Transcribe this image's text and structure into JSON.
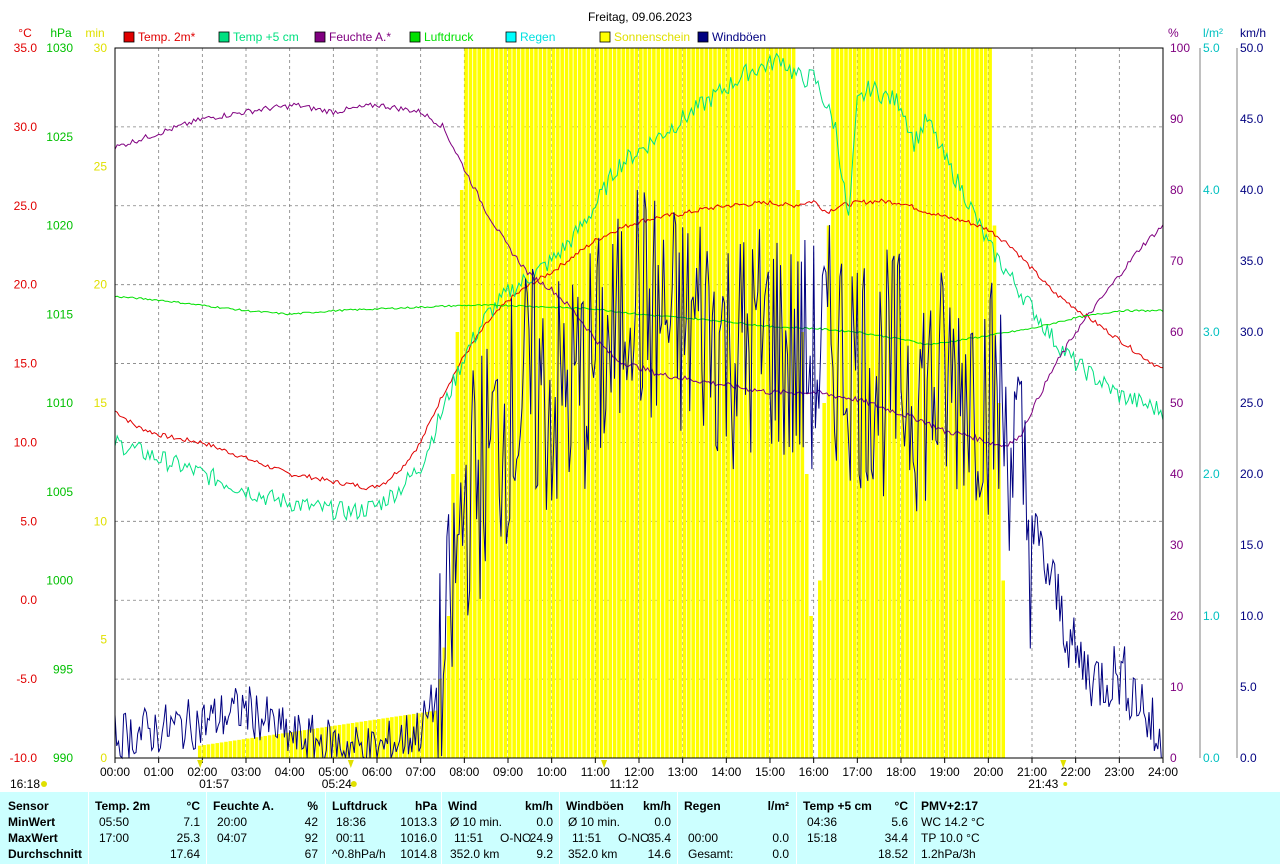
{
  "title": "Freitag, 09.06.2023",
  "colors": {
    "temp": "#e00000",
    "temp5": "#00e080",
    "humidity": "#800080",
    "pressure": "#00e000",
    "rain": "#00ffff",
    "sun": "#ffff00",
    "gust": "#000080",
    "yellow_axis": "#e0e000",
    "grid": "#808080"
  },
  "axes": {
    "left": [
      {
        "unit": "°C",
        "color": "#e00000",
        "ticks": [
          "35.0",
          "30.0",
          "25.0",
          "20.0",
          "15.0",
          "10.0",
          "5.0",
          "0.0",
          "-5.0",
          "-10.0"
        ]
      },
      {
        "unit": "hPa",
        "color": "#00c000",
        "ticks": [
          "1030",
          "1025",
          "1020",
          "1015",
          "1010",
          "1005",
          "1000",
          "995",
          "990"
        ]
      },
      {
        "unit": "min",
        "color": "#e0e000",
        "ticks": [
          "30",
          "25",
          "20",
          "15",
          "10",
          "5",
          "0"
        ]
      }
    ],
    "right": [
      {
        "unit": "%",
        "color": "#800080",
        "ticks": [
          "100",
          "90",
          "80",
          "70",
          "60",
          "50",
          "40",
          "30",
          "20",
          "10",
          "0"
        ]
      },
      {
        "unit": "l/m²",
        "color": "#00c0c0",
        "ticks": [
          "5.0",
          "4.0",
          "3.0",
          "2.0",
          "1.0",
          "0.0"
        ]
      },
      {
        "unit": "km/h",
        "color": "#000080",
        "ticks": [
          "50.0",
          "45.0",
          "40.0",
          "35.0",
          "30.0",
          "25.0",
          "20.0",
          "15.0",
          "10.0",
          "5.0",
          "0.0"
        ]
      }
    ],
    "x_ticks": [
      "00:00",
      "01:00",
      "02:00",
      "03:00",
      "04:00",
      "05:00",
      "06:00",
      "07:00",
      "08:00",
      "09:00",
      "10:00",
      "11:00",
      "12:00",
      "13:00",
      "14:00",
      "15:00",
      "16:00",
      "17:00",
      "18:00",
      "19:00",
      "20:00",
      "21:00",
      "22:00",
      "23:00",
      "24:00"
    ]
  },
  "legend": [
    {
      "label": "Temp. 2m*",
      "color": "#e00000"
    },
    {
      "label": "Temp +5 cm",
      "color": "#00e080"
    },
    {
      "label": "Feuchte A.*",
      "color": "#800080"
    },
    {
      "label": "Luftdruck",
      "color": "#00e000"
    },
    {
      "label": "Regen",
      "color": "#00ffff"
    },
    {
      "label": "Sonnenschein",
      "color": "#ffff00"
    },
    {
      "label": "Windböen",
      "color": "#000080"
    }
  ],
  "markers": {
    "left_time": "16:18",
    "sunrise": "05:24",
    "moon_a": "01:57",
    "noon": "11:12",
    "sunset": "21:43"
  },
  "chart_data": {
    "type": "line",
    "x_unit": "hour of day",
    "xlim": [
      0,
      24
    ],
    "series": [
      {
        "name": "Temp. 2m*",
        "unit": "°C",
        "ylim": [
          -10,
          35
        ],
        "x": [
          0,
          0.5,
          1,
          1.5,
          2,
          2.5,
          3,
          3.5,
          4,
          4.5,
          5,
          5.5,
          5.83,
          6.2,
          6.6,
          7,
          7.5,
          8,
          8.5,
          9,
          9.5,
          10,
          10.5,
          11,
          11.5,
          12,
          12.5,
          13,
          13.5,
          14,
          14.5,
          15,
          15.5,
          16,
          16.3,
          16.6,
          17,
          17.5,
          18,
          18.5,
          19,
          19.5,
          20,
          20.5,
          21,
          21.5,
          22,
          22.5,
          23,
          23.5,
          24
        ],
        "y": [
          12,
          11,
          10.5,
          10.2,
          10,
          9.5,
          9,
          8.5,
          8,
          7.8,
          7.5,
          7.3,
          7.1,
          7.5,
          8.5,
          10,
          13,
          15.5,
          17.5,
          19,
          20,
          20.8,
          21.8,
          22.8,
          23.5,
          24,
          24.3,
          24.5,
          24.8,
          25,
          25.1,
          25.2,
          25,
          25.3,
          24.6,
          25,
          25.2,
          25.3,
          25.2,
          24.7,
          24.3,
          24,
          23.5,
          22.5,
          21,
          19.5,
          18.5,
          17.5,
          16.5,
          15.5,
          14.6
        ]
      },
      {
        "name": "Temp +5 cm",
        "unit": "°C",
        "ylim": [
          -10,
          35
        ],
        "x": [
          0,
          0.5,
          1,
          1.5,
          2,
          2.5,
          3,
          3.5,
          4,
          4.5,
          5,
          5.5,
          6,
          6.5,
          7,
          7.5,
          8,
          8.5,
          9,
          9.5,
          10,
          10.5,
          11,
          11.5,
          12,
          12.5,
          13,
          13.5,
          14,
          14.5,
          15,
          15.25,
          15.5,
          15.75,
          16,
          16.5,
          16.8,
          17,
          17.3,
          17.6,
          18,
          18.3,
          18.6,
          19,
          19.5,
          20,
          20.5,
          21,
          21.5,
          22,
          22.5,
          23,
          23.5,
          24
        ],
        "y": [
          10,
          9.5,
          9,
          8.5,
          8,
          7.5,
          7,
          6.5,
          6.2,
          5.9,
          5.7,
          5.6,
          6,
          7,
          8.5,
          12,
          15.5,
          18,
          19.5,
          20.5,
          21.5,
          23,
          25,
          27.5,
          28.5,
          29.5,
          30.5,
          31.5,
          32.5,
          33.5,
          34,
          34.4,
          33.5,
          33,
          33.2,
          30,
          24,
          31.5,
          32.5,
          32,
          31.5,
          29,
          30.5,
          28,
          25.5,
          22.5,
          20.5,
          18.5,
          16.5,
          15,
          14,
          13,
          12.5,
          12
        ]
      },
      {
        "name": "Feuchte A.*",
        "unit": "%",
        "ylim": [
          0,
          100
        ],
        "x": [
          0,
          0.5,
          1,
          1.5,
          2,
          2.5,
          3,
          3.5,
          4,
          4.12,
          4.5,
          5,
          5.5,
          6,
          6.5,
          7,
          7.5,
          8,
          8.5,
          9,
          9.5,
          10,
          10.5,
          11,
          11.5,
          12,
          12.5,
          13,
          13.5,
          14,
          14.5,
          15,
          15.5,
          16,
          16.5,
          17,
          17.5,
          18,
          18.5,
          19,
          19.5,
          20,
          20.33,
          20.7,
          21,
          21.5,
          22,
          22.5,
          23,
          23.5,
          24
        ],
        "y": [
          86,
          87,
          88,
          89,
          90,
          90.5,
          91,
          91.5,
          91.8,
          92,
          91.5,
          91,
          91.5,
          92,
          91.5,
          91,
          89,
          83,
          77,
          72,
          68,
          66,
          63,
          59,
          56,
          55,
          54,
          53.5,
          53,
          52.5,
          52,
          51.5,
          51.5,
          51.5,
          51,
          50.5,
          49.5,
          48.5,
          47.5,
          46,
          45.5,
          44.5,
          44,
          45,
          49,
          55,
          60,
          64,
          68,
          72,
          75
        ]
      },
      {
        "name": "Luftdruck",
        "unit": "hPa",
        "ylim": [
          990,
          1030
        ],
        "x": [
          0,
          1,
          2,
          3,
          4,
          5,
          6,
          7,
          8,
          9,
          10,
          11,
          12,
          13,
          14,
          15,
          16,
          17,
          18,
          18.6,
          19,
          20,
          21,
          22,
          23,
          24
        ],
        "y": [
          1016,
          1015.8,
          1015.5,
          1015.2,
          1015,
          1015.2,
          1015.3,
          1015.4,
          1015.5,
          1015.5,
          1015.4,
          1015.3,
          1015,
          1014.8,
          1014.6,
          1014.3,
          1014.2,
          1014,
          1013.6,
          1013.3,
          1013.4,
          1013.8,
          1014.2,
          1014.8,
          1015.2,
          1015.2
        ]
      },
      {
        "name": "Windböen",
        "unit": "km/h",
        "ylim": [
          0,
          50
        ],
        "x": [
          0,
          1,
          2,
          3,
          4,
          5,
          6,
          7,
          7.5,
          8,
          8.5,
          9,
          9.5,
          10,
          10.5,
          11,
          11.5,
          11.85,
          12,
          12.5,
          13,
          13.5,
          14,
          14.5,
          15,
          15.5,
          16,
          16.5,
          17,
          17.5,
          18,
          18.5,
          19,
          19.5,
          20,
          20.5,
          21,
          21.5,
          22,
          22.5,
          23,
          23.5,
          24
        ],
        "y": [
          1.5,
          2,
          2.5,
          3.5,
          1.5,
          1,
          0.5,
          2,
          5,
          18,
          21,
          24,
          26,
          25,
          26,
          28,
          29,
          35.4,
          32,
          31,
          30,
          31,
          29,
          29,
          30,
          28,
          28,
          29,
          28,
          27,
          27,
          26,
          26,
          27,
          26,
          23,
          16,
          12,
          7,
          5.5,
          6,
          4,
          0
        ]
      },
      {
        "name": "Sonnenschein",
        "unit": "min",
        "ylim": [
          0,
          30
        ],
        "x": [
          0,
          7.3,
          7.6,
          8,
          11,
          15,
          15.5,
          16,
          16.4,
          17,
          20,
          20.4,
          24
        ],
        "y": [
          0,
          2,
          6,
          30,
          30,
          30,
          30,
          0,
          30,
          30,
          30,
          0,
          0
        ]
      }
    ]
  },
  "stats": {
    "headers": [
      {
        "label": "Sensor"
      },
      {
        "label": "Temp. 2m",
        "unit": "°C"
      },
      {
        "label": "Feuchte A.",
        "unit": "%"
      },
      {
        "label": "Luftdruck",
        "unit": "hPa"
      },
      {
        "label": "Wind",
        "unit": "km/h"
      },
      {
        "label": "Windböen",
        "unit": "km/h"
      },
      {
        "label": "Regen",
        "unit": "l/m²"
      },
      {
        "label": "Temp +5 cm",
        "unit": "°C"
      },
      {
        "label": "PMV+2:17"
      }
    ],
    "row_labels": [
      "MinWert",
      "MaxWert",
      "Durchschnitt"
    ],
    "temp2m": [
      {
        "t": "05:50",
        "v": "7.1"
      },
      {
        "t": "17:00",
        "v": "25.3"
      },
      {
        "t": "",
        "v": "17.64"
      }
    ],
    "humidity": [
      {
        "t": "20:00",
        "v": "42"
      },
      {
        "t": "04:07",
        "v": "92"
      },
      {
        "t": "",
        "v": "67"
      }
    ],
    "pressure": [
      {
        "t": "18:36",
        "v": "1013.3"
      },
      {
        "t": "00:11",
        "v": "1016.0"
      },
      {
        "t": "^0.8hPa/h",
        "v": "1014.8"
      }
    ],
    "wind": [
      {
        "t": "Ø 10 min.",
        "d": "",
        "v": "0.0"
      },
      {
        "t": "11:51",
        "d": "O-NO",
        "v": "24.9"
      },
      {
        "t": "352.0 km",
        "d": "",
        "v": "9.2"
      }
    ],
    "gust": [
      {
        "t": "Ø 10 min.",
        "d": "",
        "v": "0.0"
      },
      {
        "t": "11:51",
        "d": "O-NO",
        "v": "35.4"
      },
      {
        "t": "352.0 km",
        "d": "",
        "v": "14.6"
      }
    ],
    "rain": [
      {
        "t": "",
        "v": ""
      },
      {
        "t": "00:00",
        "v": "0.0"
      },
      {
        "t": "Gesamt:",
        "v": "0.0"
      }
    ],
    "temp5": [
      {
        "t": "04:36",
        "v": "5.6"
      },
      {
        "t": "15:18",
        "v": "34.4"
      },
      {
        "t": "",
        "v": "18.52"
      }
    ],
    "pmv": [
      "WC 14.2 °C",
      "TP 10.0 °C",
      "1.2hPa/3h"
    ]
  }
}
